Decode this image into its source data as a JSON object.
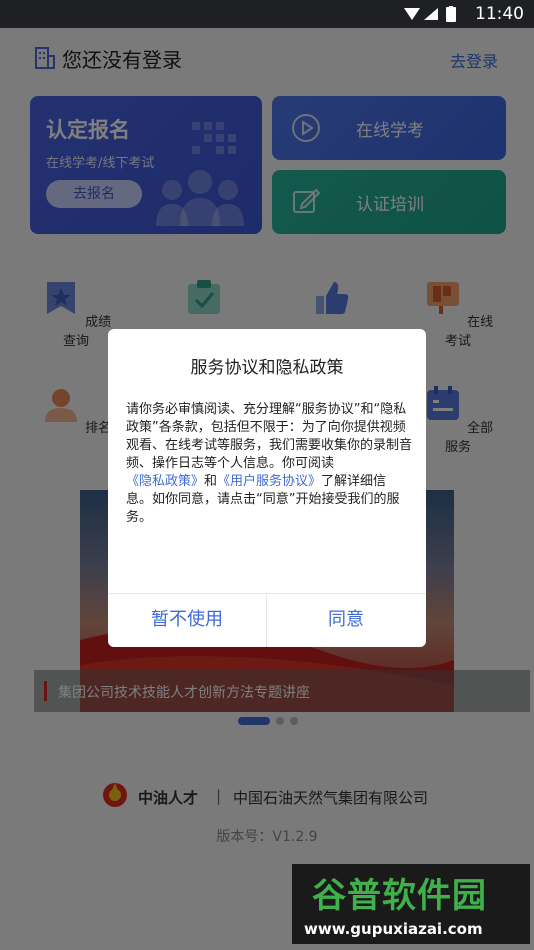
{
  "status_bar": {
    "time": "11:40"
  },
  "header": {
    "title": "您还没有登录",
    "login_label": "去登录"
  },
  "register_card": {
    "title": "认定报名",
    "subtitle": "在线学考/线下考试",
    "button": "去报名"
  },
  "side_cards": {
    "online": "在线学考",
    "training": "认证培训"
  },
  "grid": {
    "items": [
      "成绩查询",
      "在线考试",
      "排名",
      "全部服务"
    ]
  },
  "banner": {
    "caption": "集团公司技术技能人才创新方法专题讲座"
  },
  "footer": {
    "brand": "中油人才",
    "separator": "|",
    "company": "中国石油天然气集团有限公司",
    "version": "版本号：V1.2.9"
  },
  "dialog": {
    "title": "服务协议和隐私政策",
    "body_1": "请你务必审慎阅读、充分理解“服务协议”和“隐私政策”各条款，包括但不限于：为了向你提供视频观看、在线考试等服务，我们需要收集你的录制音频、操作日志等个人信息。你可阅读",
    "link_privacy": "《隐私政策》",
    "body_2": "和",
    "link_user": "《用户服务协议》",
    "body_3": "了解详细信息。如你同意，请点击“同意”开始接受我们的服务。",
    "decline": "暂不使用",
    "agree": "同意"
  },
  "watermark": {
    "title": "谷普软件园",
    "url": "www.gupuxiazai.com"
  },
  "colors": {
    "accent": "#3e6bd8",
    "register": "#3a57d6",
    "training": "#1ea48b"
  }
}
